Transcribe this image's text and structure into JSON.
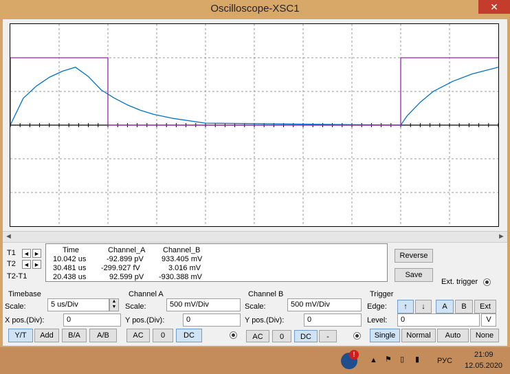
{
  "window": {
    "title": "Oscilloscope-XSC1",
    "close_glyph": "✕"
  },
  "chart_data": {
    "type": "line",
    "series": [
      {
        "name": "Channel A",
        "color": "#0072c6",
        "x": [
          0.0,
          2.0,
          4.0,
          6.0,
          8.0,
          10.0,
          12.0,
          14.0,
          16.0,
          18.0,
          20.0,
          22.0,
          25.0,
          30.0,
          60.0,
          61.0,
          63.0,
          65.0,
          68.0,
          71.0,
          75.0
        ],
        "y": [
          0.0,
          0.4,
          0.58,
          0.71,
          0.8,
          0.86,
          0.72,
          0.52,
          0.4,
          0.3,
          0.22,
          0.16,
          0.1,
          0.03,
          0.0,
          0.14,
          0.34,
          0.5,
          0.65,
          0.76,
          0.86
        ]
      },
      {
        "name": "Channel B",
        "color": "#9b1fb1",
        "x": [
          0.0,
          0.0,
          15.0,
          15.0,
          60.0,
          60.0,
          75.0
        ],
        "y": [
          0.0,
          1.0,
          1.0,
          0.0,
          0.0,
          1.0,
          1.0
        ]
      }
    ],
    "xlim": [
      0,
      75
    ],
    "ylim": [
      -1.5,
      1.5
    ],
    "grid": true
  },
  "cursors": {
    "t1_label": "T1",
    "t2_label": "T2",
    "t2t1_label": "T2-T1",
    "left_glyph": "◄",
    "right_glyph": "►"
  },
  "readout": {
    "headers": [
      "Time",
      "Channel_A",
      "Channel_B"
    ],
    "rows": [
      [
        "10.042 us",
        "-92.899 pV",
        "933.405 mV"
      ],
      [
        "30.481 us",
        "-299.927 fV",
        "3.016 mV"
      ],
      [
        "20.438 us",
        "92.599 pV",
        "-930.388 mV"
      ]
    ]
  },
  "buttons": {
    "reverse": "Reverse",
    "save": "Save",
    "ext_trigger": "Ext. trigger"
  },
  "timebase": {
    "title": "Timebase",
    "scale_label": "Scale:",
    "scale_value": "5 us/Div",
    "xpos_label": "X pos.(Div):",
    "xpos_value": "0",
    "modes": [
      "Y/T",
      "Add",
      "B/A",
      "A/B"
    ]
  },
  "channel_a": {
    "title": "Channel A",
    "scale_label": "Scale:",
    "scale_value": "500 mV/Div",
    "ypos_label": "Y pos.(Div):",
    "ypos_value": "0",
    "coupling": [
      "AC",
      "0",
      "DC"
    ]
  },
  "channel_b": {
    "title": "Channel B",
    "scale_label": "Scale:",
    "scale_value": "500 mV/Div",
    "ypos_label": "Y pos.(Div):",
    "ypos_value": "0",
    "coupling": [
      "AC",
      "0",
      "DC",
      "-"
    ]
  },
  "trigger": {
    "title": "Trigger",
    "edge_label": "Edge:",
    "edge_rise": "↑",
    "edge_fall": "↓",
    "sources": [
      "A",
      "B",
      "Ext"
    ],
    "level_label": "Level:",
    "level_value": "0",
    "level_unit": "V",
    "modes": [
      "Single",
      "Normal",
      "Auto",
      "None"
    ]
  },
  "taskbar": {
    "lang": "РУС",
    "time": "21:09",
    "date": "12.05.2020"
  }
}
